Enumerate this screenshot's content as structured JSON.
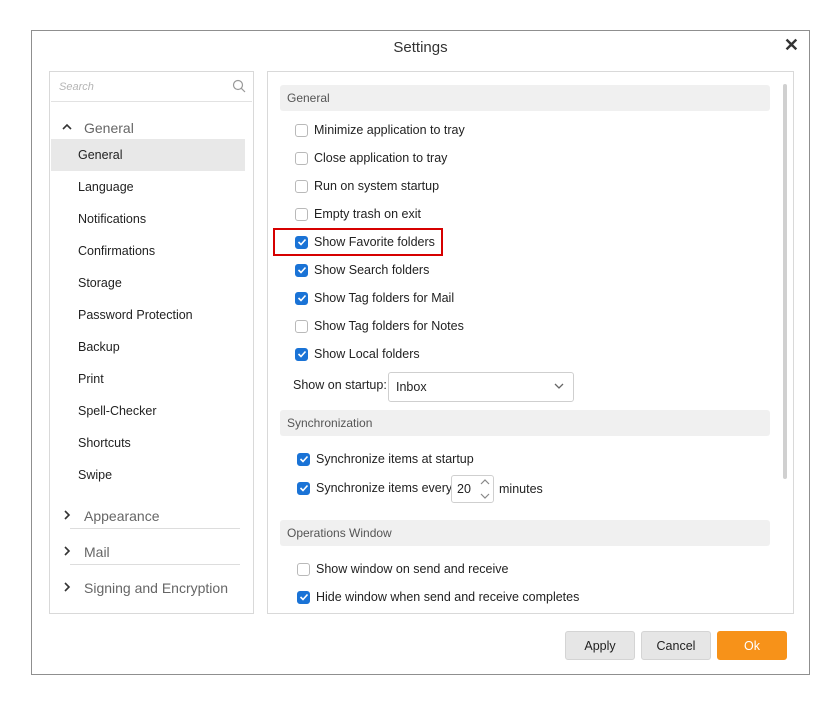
{
  "window": {
    "title": "Settings"
  },
  "sidebar": {
    "search_placeholder": "Search",
    "groups": [
      {
        "label": "General",
        "expanded": true
      },
      {
        "label": "Appearance",
        "expanded": false
      },
      {
        "label": "Mail",
        "expanded": false
      },
      {
        "label": "Signing and Encryption",
        "expanded": false
      }
    ],
    "items": [
      {
        "label": "General",
        "active": true
      },
      {
        "label": "Language"
      },
      {
        "label": "Notifications"
      },
      {
        "label": "Confirmations"
      },
      {
        "label": "Storage"
      },
      {
        "label": "Password Protection"
      },
      {
        "label": "Backup"
      },
      {
        "label": "Print"
      },
      {
        "label": "Spell-Checker"
      },
      {
        "label": "Shortcuts"
      },
      {
        "label": "Swipe"
      }
    ]
  },
  "general": {
    "header": "General",
    "options": [
      {
        "label": "Minimize application to tray",
        "checked": false
      },
      {
        "label": "Close application to tray",
        "checked": false
      },
      {
        "label": "Run on system startup",
        "checked": false
      },
      {
        "label": "Empty trash on exit",
        "checked": false
      },
      {
        "label": "Show Favorite folders",
        "checked": true
      },
      {
        "label": "Show Search folders",
        "checked": true
      },
      {
        "label": "Show Tag folders for Mail",
        "checked": true
      },
      {
        "label": "Show Tag folders for Notes",
        "checked": false
      },
      {
        "label": "Show Local folders",
        "checked": true
      }
    ],
    "startup_label": "Show on startup:",
    "startup_value": "Inbox"
  },
  "sync": {
    "header": "Synchronization",
    "options": [
      {
        "label": "Synchronize items at startup",
        "checked": true
      },
      {
        "label": "Synchronize items every",
        "checked": true
      }
    ],
    "interval": "20",
    "unit": "minutes"
  },
  "ops": {
    "header": "Operations Window",
    "options": [
      {
        "label": "Show window on send and receive",
        "checked": false
      },
      {
        "label": "Hide window when send and receive completes",
        "checked": true
      }
    ]
  },
  "buttons": {
    "apply": "Apply",
    "cancel": "Cancel",
    "ok": "Ok"
  },
  "colors": {
    "accent": "#1a73d6",
    "ok_button": "#f79219",
    "highlight": "#d60000"
  }
}
